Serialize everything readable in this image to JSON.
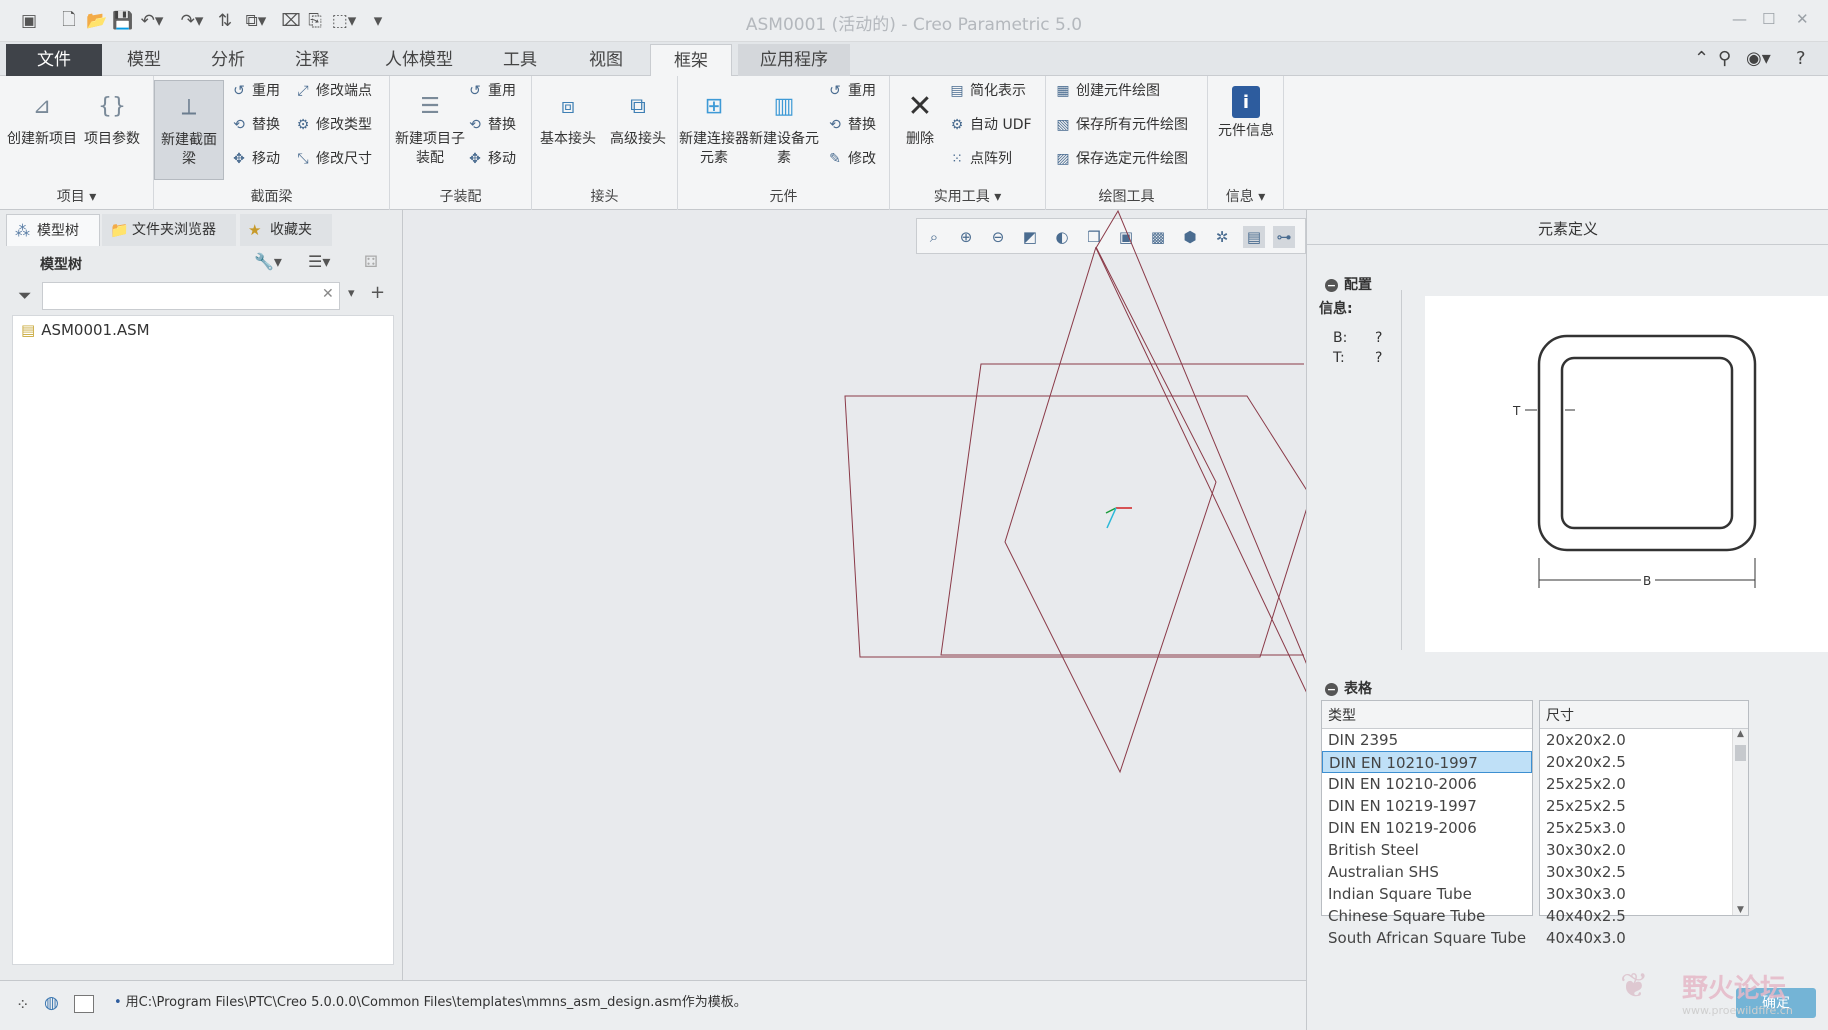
{
  "titlebar": {
    "title": "ASM0001 (活动的) - Creo Parametric 5.0"
  },
  "tabs": [
    "文件",
    "模型",
    "分析",
    "注释",
    "人体模型",
    "工具",
    "视图",
    "框架",
    "应用程序"
  ],
  "ribbon": {
    "project": {
      "label": "项目",
      "new_item": "创建新项目",
      "item_params": "项目参数"
    },
    "section": {
      "label": "截面梁",
      "new_beam": "新建截面梁",
      "reuse": "重用",
      "replace": "替换",
      "move": "移动",
      "modify_end": "修改端点",
      "modify_type": "修改类型",
      "modify_size": "修改尺寸"
    },
    "subasm": {
      "label": "子装配",
      "new_sub": "新建项目子装配",
      "reuse": "重用",
      "replace": "替换",
      "move": "移动"
    },
    "joint": {
      "label": "接头",
      "basic": "基本接头",
      "advanced": "高级接头"
    },
    "component": {
      "label": "元件",
      "new_conn": "新建连接器元素",
      "new_equip": "新建设备元素",
      "reuse": "重用",
      "replace": "替换",
      "modify": "修改"
    },
    "utility": {
      "label": "实用工具",
      "delete": "删除",
      "simplified": "简化表示",
      "auto_udf": "自动 UDF",
      "pattern": "点阵列"
    },
    "drawing": {
      "label": "绘图工具",
      "create": "创建元件绘图",
      "save_all": "保存所有元件绘图",
      "save_sel": "保存选定元件绘图"
    },
    "info": {
      "label": "信息",
      "comp_info": "元件信息"
    }
  },
  "leftpanel": {
    "tabs": [
      "模型树",
      "文件夹浏览器",
      "收藏夹"
    ],
    "tree_label": "模型树",
    "search_placeholder": "",
    "root": "ASM0001.ASM"
  },
  "rightpanel": {
    "title": "元素定义",
    "config": {
      "label": "配置",
      "info_label": "信息:",
      "b_label": "B:",
      "b_value": "?",
      "t_label": "T:",
      "t_value": "?",
      "dim_t": "T",
      "dim_b": "B"
    },
    "table": {
      "label": "表格",
      "type_header": "类型",
      "size_header": "尺寸",
      "types": [
        "DIN 2395",
        "DIN EN 10210-1997",
        "DIN EN 10210-2006",
        "DIN EN 10219-1997",
        "DIN EN 10219-2006",
        "British Steel",
        "Australian SHS",
        "Indian Square Tube",
        "Chinese Square Tube",
        "South African Square Tube"
      ],
      "selected_type_index": 1,
      "sizes": [
        "20x20x2.0",
        "20x20x2.5",
        "25x25x2.0",
        "25x25x2.5",
        "25x25x3.0",
        "30x30x2.0",
        "30x30x2.5",
        "30x30x3.0",
        "40x40x2.5",
        "40x40x3.0"
      ]
    },
    "ok": "确定"
  },
  "statusbar": {
    "message": "用C:\\Program Files\\PTC\\Creo 5.0.0.0\\Common Files\\templates\\mmns_asm_design.asm作为模板。"
  },
  "watermark": {
    "text": "野火论坛",
    "url": "www.proewildfire.cn"
  }
}
